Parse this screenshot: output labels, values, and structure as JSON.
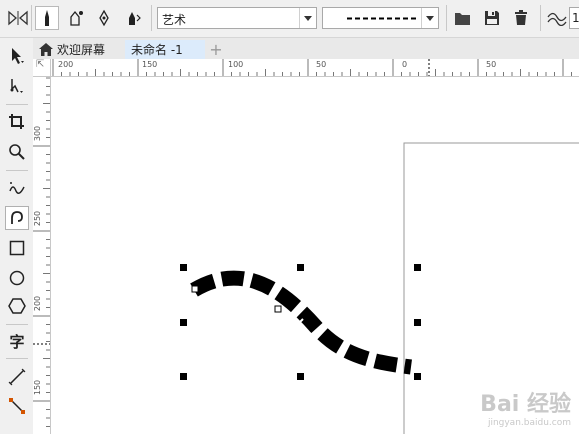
{
  "property_bar": {
    "style_combo_value": "艺术",
    "stroke_combo_value": "- - - - - - -",
    "tools": [
      "mirror-icon",
      "preset-brush-icon",
      "brush-icon",
      "sprayer-icon",
      "calligraphy-icon",
      "pressure-icon",
      "open-icon",
      "save-icon",
      "delete-icon",
      "smoothing-icon"
    ],
    "smoothing_value": "1"
  },
  "tabs": {
    "home": "欢迎屏幕",
    "document": "未命名 -1",
    "add_symbol": "+"
  },
  "rulers": {
    "horizontal": [
      "200",
      "150",
      "100",
      "50",
      "0",
      "50"
    ],
    "vertical": [
      "300",
      "250",
      "200",
      "150"
    ],
    "corner_symbol": "⇱"
  },
  "toolbox": {
    "text_tool_label": "字"
  },
  "watermark": {
    "line1": "Bai 经验",
    "line2": "jingyan.baidu.com"
  },
  "colors": {
    "selection_handle": "#000000",
    "stroke": "#000000",
    "accent_tab": "#dcebfb"
  }
}
